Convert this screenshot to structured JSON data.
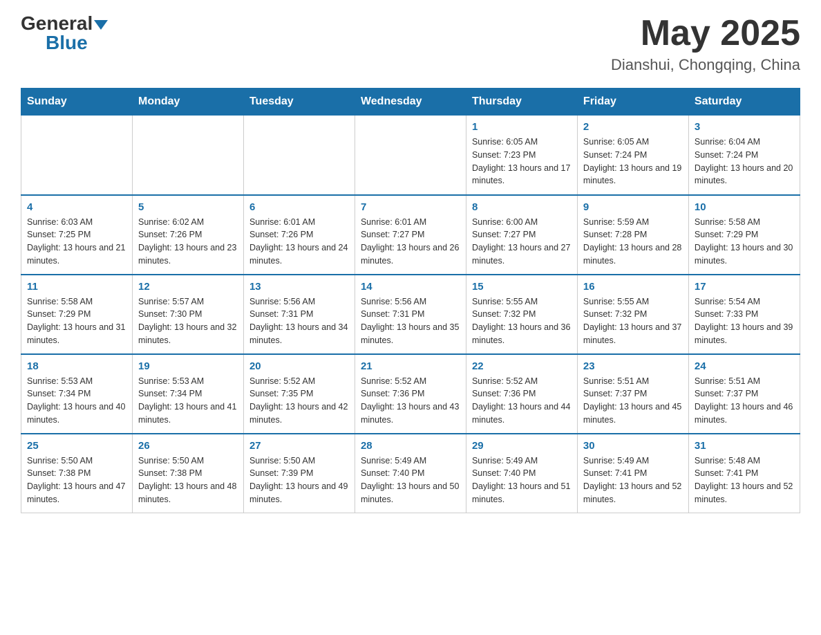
{
  "header": {
    "logo_general": "General",
    "logo_blue": "Blue",
    "month_title": "May 2025",
    "location": "Dianshui, Chongqing, China"
  },
  "days_of_week": [
    "Sunday",
    "Monday",
    "Tuesday",
    "Wednesday",
    "Thursday",
    "Friday",
    "Saturday"
  ],
  "weeks": [
    [
      {
        "day": "",
        "info": ""
      },
      {
        "day": "",
        "info": ""
      },
      {
        "day": "",
        "info": ""
      },
      {
        "day": "",
        "info": ""
      },
      {
        "day": "1",
        "info": "Sunrise: 6:05 AM\nSunset: 7:23 PM\nDaylight: 13 hours and 17 minutes."
      },
      {
        "day": "2",
        "info": "Sunrise: 6:05 AM\nSunset: 7:24 PM\nDaylight: 13 hours and 19 minutes."
      },
      {
        "day": "3",
        "info": "Sunrise: 6:04 AM\nSunset: 7:24 PM\nDaylight: 13 hours and 20 minutes."
      }
    ],
    [
      {
        "day": "4",
        "info": "Sunrise: 6:03 AM\nSunset: 7:25 PM\nDaylight: 13 hours and 21 minutes."
      },
      {
        "day": "5",
        "info": "Sunrise: 6:02 AM\nSunset: 7:26 PM\nDaylight: 13 hours and 23 minutes."
      },
      {
        "day": "6",
        "info": "Sunrise: 6:01 AM\nSunset: 7:26 PM\nDaylight: 13 hours and 24 minutes."
      },
      {
        "day": "7",
        "info": "Sunrise: 6:01 AM\nSunset: 7:27 PM\nDaylight: 13 hours and 26 minutes."
      },
      {
        "day": "8",
        "info": "Sunrise: 6:00 AM\nSunset: 7:27 PM\nDaylight: 13 hours and 27 minutes."
      },
      {
        "day": "9",
        "info": "Sunrise: 5:59 AM\nSunset: 7:28 PM\nDaylight: 13 hours and 28 minutes."
      },
      {
        "day": "10",
        "info": "Sunrise: 5:58 AM\nSunset: 7:29 PM\nDaylight: 13 hours and 30 minutes."
      }
    ],
    [
      {
        "day": "11",
        "info": "Sunrise: 5:58 AM\nSunset: 7:29 PM\nDaylight: 13 hours and 31 minutes."
      },
      {
        "day": "12",
        "info": "Sunrise: 5:57 AM\nSunset: 7:30 PM\nDaylight: 13 hours and 32 minutes."
      },
      {
        "day": "13",
        "info": "Sunrise: 5:56 AM\nSunset: 7:31 PM\nDaylight: 13 hours and 34 minutes."
      },
      {
        "day": "14",
        "info": "Sunrise: 5:56 AM\nSunset: 7:31 PM\nDaylight: 13 hours and 35 minutes."
      },
      {
        "day": "15",
        "info": "Sunrise: 5:55 AM\nSunset: 7:32 PM\nDaylight: 13 hours and 36 minutes."
      },
      {
        "day": "16",
        "info": "Sunrise: 5:55 AM\nSunset: 7:32 PM\nDaylight: 13 hours and 37 minutes."
      },
      {
        "day": "17",
        "info": "Sunrise: 5:54 AM\nSunset: 7:33 PM\nDaylight: 13 hours and 39 minutes."
      }
    ],
    [
      {
        "day": "18",
        "info": "Sunrise: 5:53 AM\nSunset: 7:34 PM\nDaylight: 13 hours and 40 minutes."
      },
      {
        "day": "19",
        "info": "Sunrise: 5:53 AM\nSunset: 7:34 PM\nDaylight: 13 hours and 41 minutes."
      },
      {
        "day": "20",
        "info": "Sunrise: 5:52 AM\nSunset: 7:35 PM\nDaylight: 13 hours and 42 minutes."
      },
      {
        "day": "21",
        "info": "Sunrise: 5:52 AM\nSunset: 7:36 PM\nDaylight: 13 hours and 43 minutes."
      },
      {
        "day": "22",
        "info": "Sunrise: 5:52 AM\nSunset: 7:36 PM\nDaylight: 13 hours and 44 minutes."
      },
      {
        "day": "23",
        "info": "Sunrise: 5:51 AM\nSunset: 7:37 PM\nDaylight: 13 hours and 45 minutes."
      },
      {
        "day": "24",
        "info": "Sunrise: 5:51 AM\nSunset: 7:37 PM\nDaylight: 13 hours and 46 minutes."
      }
    ],
    [
      {
        "day": "25",
        "info": "Sunrise: 5:50 AM\nSunset: 7:38 PM\nDaylight: 13 hours and 47 minutes."
      },
      {
        "day": "26",
        "info": "Sunrise: 5:50 AM\nSunset: 7:38 PM\nDaylight: 13 hours and 48 minutes."
      },
      {
        "day": "27",
        "info": "Sunrise: 5:50 AM\nSunset: 7:39 PM\nDaylight: 13 hours and 49 minutes."
      },
      {
        "day": "28",
        "info": "Sunrise: 5:49 AM\nSunset: 7:40 PM\nDaylight: 13 hours and 50 minutes."
      },
      {
        "day": "29",
        "info": "Sunrise: 5:49 AM\nSunset: 7:40 PM\nDaylight: 13 hours and 51 minutes."
      },
      {
        "day": "30",
        "info": "Sunrise: 5:49 AM\nSunset: 7:41 PM\nDaylight: 13 hours and 52 minutes."
      },
      {
        "day": "31",
        "info": "Sunrise: 5:48 AM\nSunset: 7:41 PM\nDaylight: 13 hours and 52 minutes."
      }
    ]
  ]
}
